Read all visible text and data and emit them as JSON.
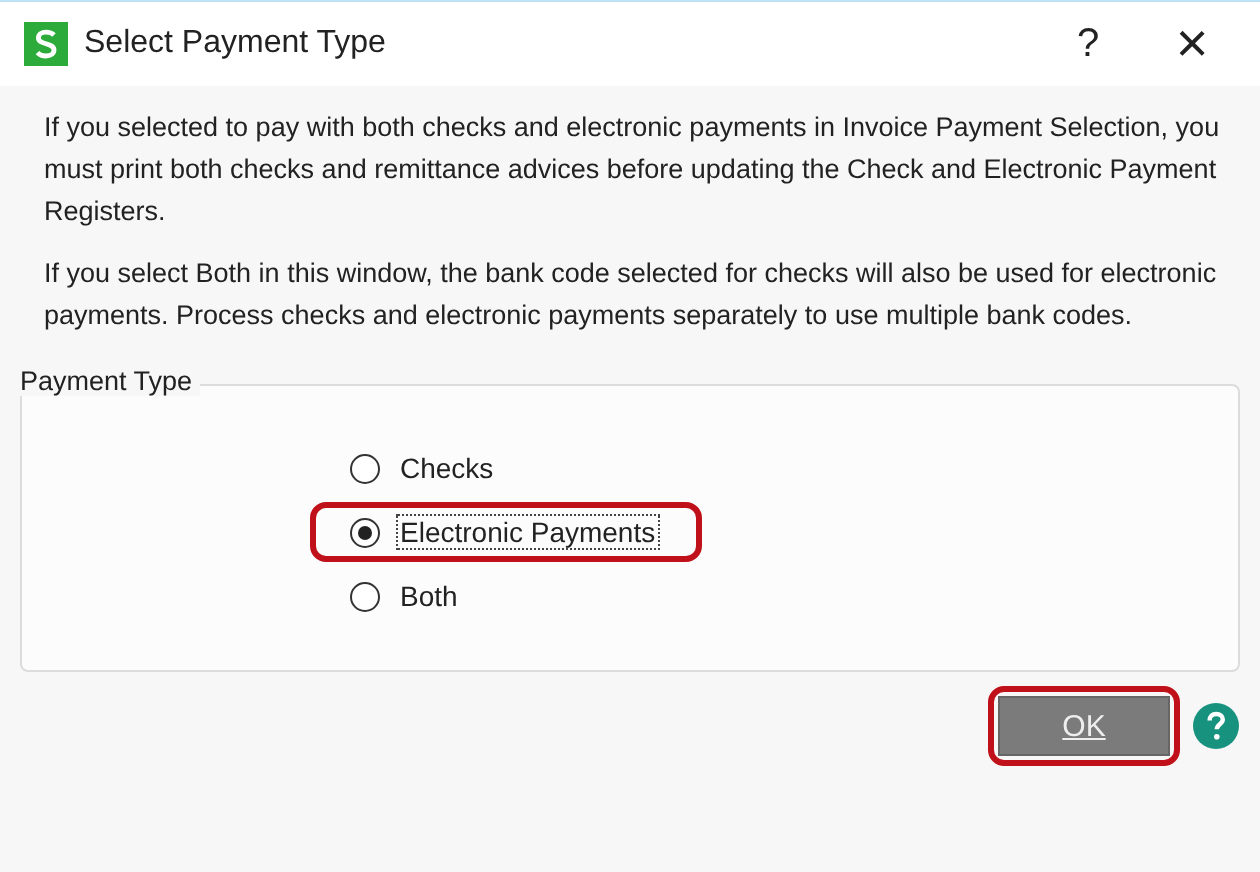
{
  "window": {
    "title": "Select Payment Type",
    "help_glyph": "?",
    "close_glyph": "×"
  },
  "paragraphs": [
    "If you selected to pay with both checks and electronic payments in Invoice Payment Selection, you must print both checks and remittance advices before updating the Check and Electronic Payment Registers.",
    "If you select Both in this window, the bank code selected for checks will also be used for electronic payments. Process checks and electronic payments separately to use multiple bank codes."
  ],
  "payment_type": {
    "label": "Payment Type",
    "options": [
      {
        "label": "Checks",
        "selected": false,
        "highlighted": false
      },
      {
        "label": "Electronic Payments",
        "selected": true,
        "highlighted": true
      },
      {
        "label": "Both",
        "selected": false,
        "highlighted": false
      }
    ]
  },
  "ok_button": {
    "label": "OK",
    "highlighted": true
  }
}
